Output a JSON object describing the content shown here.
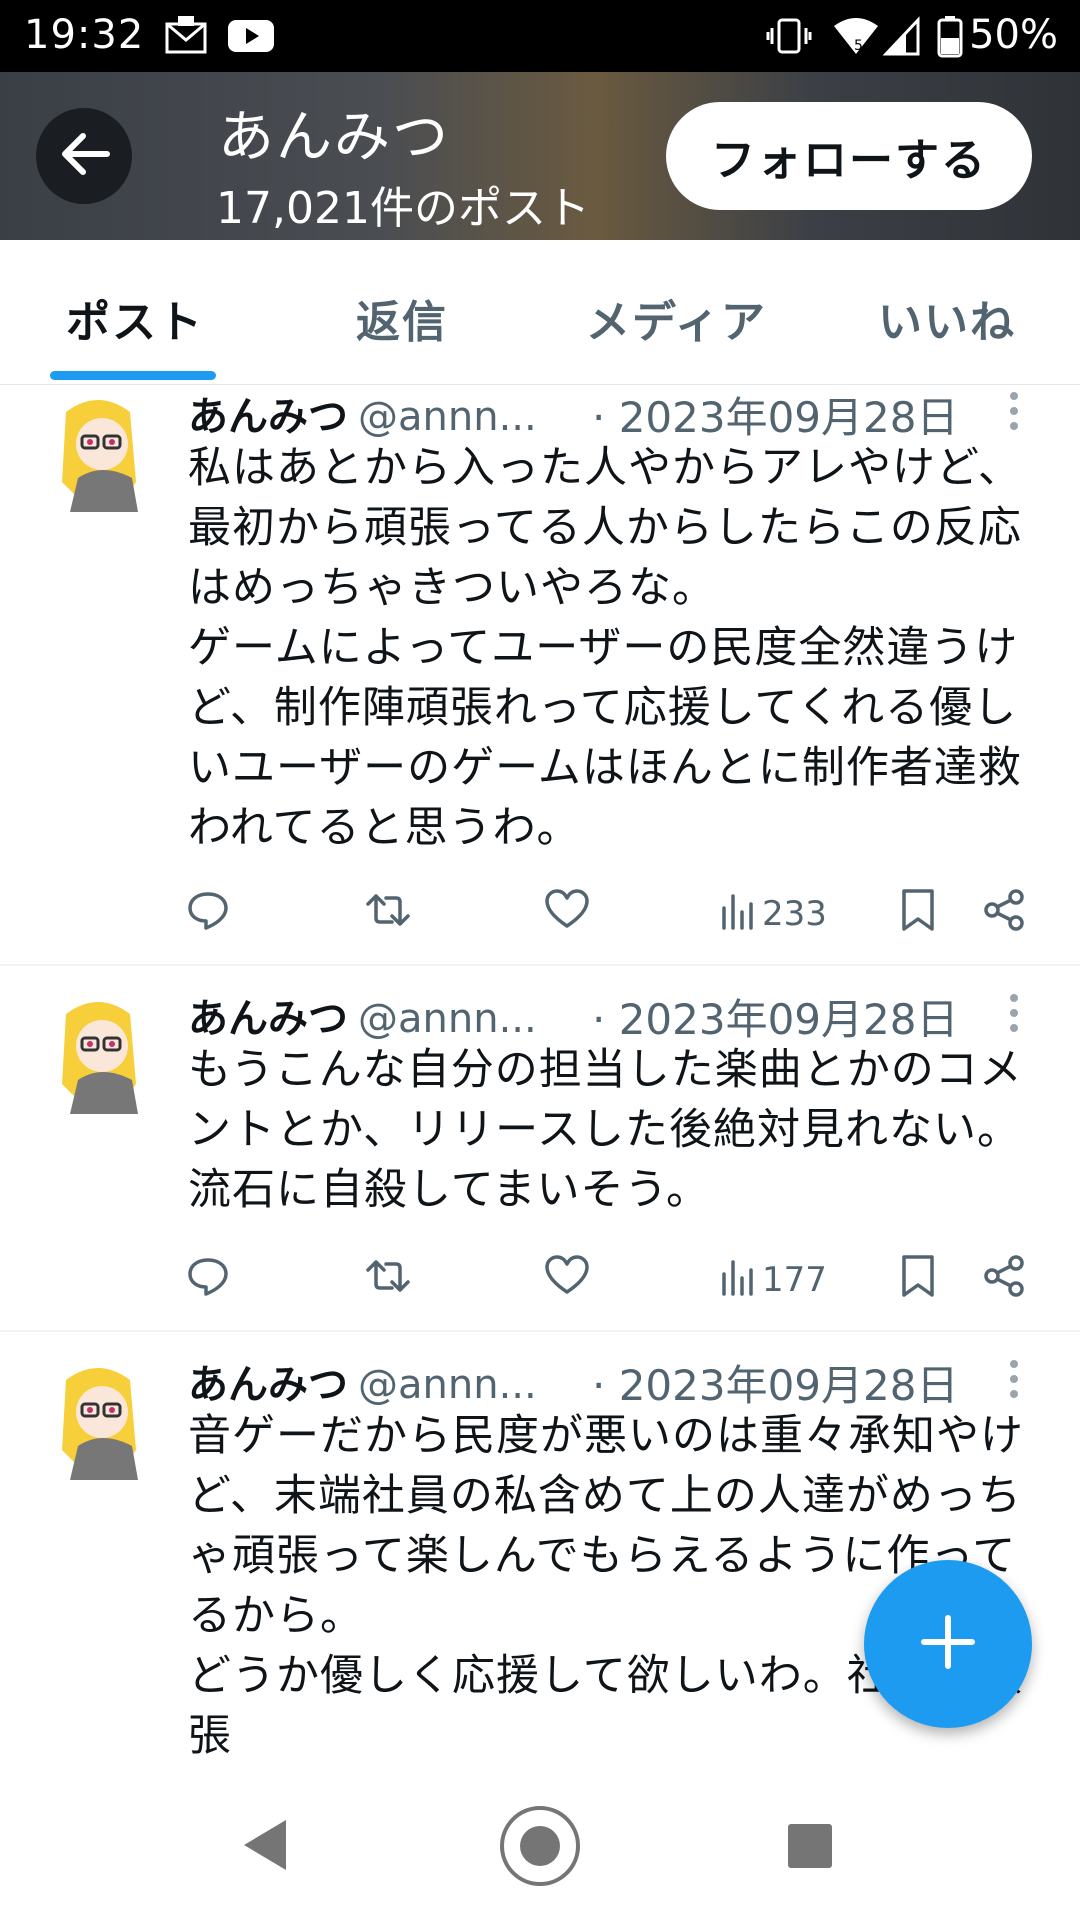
{
  "status_bar": {
    "time": "19:32",
    "battery": "50%"
  },
  "header": {
    "name": "あんみつ",
    "post_count": "17,021件のポスト",
    "follow_label": "フォローする"
  },
  "tabs": [
    "ポスト",
    "返信",
    "メディア",
    "いいね"
  ],
  "posts": [
    {
      "name": "あんみつ",
      "handle": "@annn...",
      "date": "· 2023年09月28日",
      "text": "私はあとから入った人やからアレやけど、\n最初から頑張ってる人からしたらこの反応\nはめっちゃきついやろな。\nゲームによってユーザーの民度全然違うけ\nど、制作陣頑張れって応援してくれる優し\nいユーザーのゲームはほんとに制作者達救\nわれてると思うわ。",
      "views": "233"
    },
    {
      "name": "あんみつ",
      "handle": "@annn...",
      "date": "· 2023年09月28日",
      "text": "もうこんな自分の担当した楽曲とかのコメ\nントとか、リリースした後絶対見れない。\n流石に自殺してまいそう。",
      "views": "177"
    },
    {
      "name": "あんみつ",
      "handle": "@annn...",
      "date": "· 2023年09月28日",
      "text": "音ゲーだから民度が悪いのは重々承知やけ\nど、末端社員の私含めて上の人達がめっち\nゃ頑張って楽しんでもらえるように作って\nるから。\nどうか優しく応援して欲しいわ。社員も頑張\nるから。",
      "views": ""
    }
  ],
  "colors": {
    "accent": "#1d9bf0",
    "text": "#0f1419",
    "muted": "#536471"
  }
}
